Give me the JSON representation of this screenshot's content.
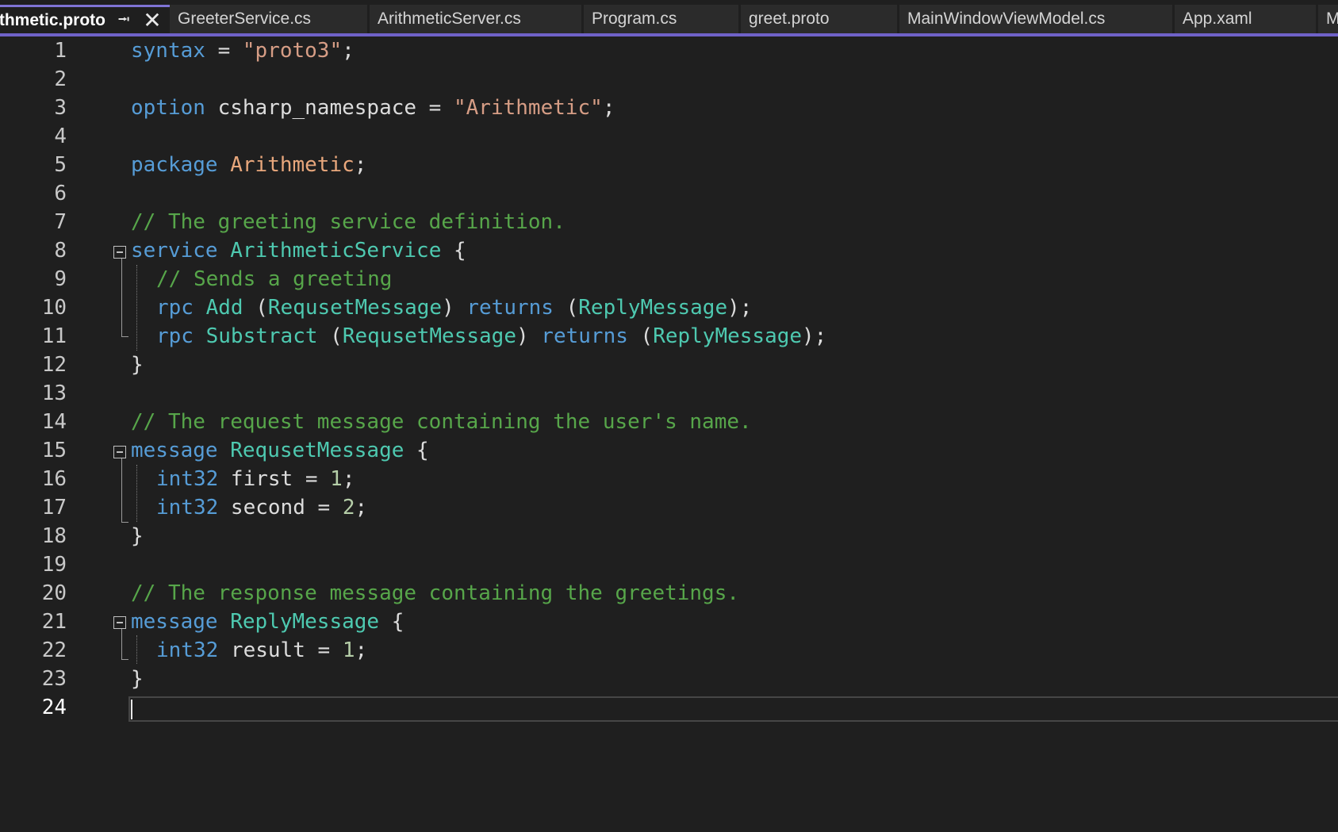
{
  "tabs": [
    {
      "label": "thmetic.proto",
      "active": true
    },
    {
      "label": "GreeterService.cs",
      "active": false
    },
    {
      "label": "ArithmeticServer.cs",
      "active": false
    },
    {
      "label": "Program.cs",
      "active": false
    },
    {
      "label": "greet.proto",
      "active": false
    },
    {
      "label": "MainWindowViewModel.cs",
      "active": false
    },
    {
      "label": "App.xaml",
      "active": false
    },
    {
      "label": "M",
      "active": false
    }
  ],
  "tab_icons": {
    "pin": "pin-icon",
    "close": "close-icon"
  },
  "current_line": 24,
  "colors": {
    "background": "#1f1f1f",
    "keyword": "#569cd6",
    "string": "#d69d85",
    "comment": "#57a64a",
    "type": "#4ec9b0",
    "number": "#b5cea8",
    "accent": "#7f73d4"
  },
  "lines": [
    {
      "n": "1",
      "indent": false,
      "tokens": [
        [
          "kw",
          "syntax"
        ],
        [
          "pl",
          " = "
        ],
        [
          "str",
          "\"proto3\""
        ],
        [
          "pl",
          ";"
        ]
      ]
    },
    {
      "n": "2",
      "indent": false,
      "tokens": []
    },
    {
      "n": "3",
      "indent": false,
      "tokens": [
        [
          "kw",
          "option"
        ],
        [
          "pl",
          " csharp_namespace = "
        ],
        [
          "str",
          "\"Arithmetic\""
        ],
        [
          "pl",
          ";"
        ]
      ]
    },
    {
      "n": "4",
      "indent": false,
      "tokens": []
    },
    {
      "n": "5",
      "indent": false,
      "tokens": [
        [
          "kw",
          "package"
        ],
        [
          "pl",
          " "
        ],
        [
          "ns",
          "Arithmetic"
        ],
        [
          "pl",
          ";"
        ]
      ]
    },
    {
      "n": "6",
      "indent": false,
      "tokens": []
    },
    {
      "n": "7",
      "indent": false,
      "tokens": [
        [
          "cmt",
          "// The greeting service definition."
        ]
      ]
    },
    {
      "n": "8",
      "indent": false,
      "fold": true,
      "tokens": [
        [
          "kw",
          "service"
        ],
        [
          "pl",
          " "
        ],
        [
          "typ",
          "ArithmeticService"
        ],
        [
          "pl",
          " {"
        ]
      ]
    },
    {
      "n": "9",
      "indent": true,
      "tokens": [
        [
          "cmt",
          "// Sends a greeting"
        ]
      ]
    },
    {
      "n": "10",
      "indent": true,
      "tokens": [
        [
          "kw",
          "rpc"
        ],
        [
          "pl",
          " "
        ],
        [
          "typ",
          "Add"
        ],
        [
          "pl",
          " ("
        ],
        [
          "typ",
          "RequsetMessage"
        ],
        [
          "pl",
          ") "
        ],
        [
          "kw",
          "returns"
        ],
        [
          "pl",
          " ("
        ],
        [
          "typ",
          "ReplyMessage"
        ],
        [
          "pl",
          ");"
        ]
      ]
    },
    {
      "n": "11",
      "indent": true,
      "tokens": [
        [
          "kw",
          "rpc"
        ],
        [
          "pl",
          " "
        ],
        [
          "typ",
          "Substract"
        ],
        [
          "pl",
          " ("
        ],
        [
          "typ",
          "RequsetMessage"
        ],
        [
          "pl",
          ") "
        ],
        [
          "kw",
          "returns"
        ],
        [
          "pl",
          " ("
        ],
        [
          "typ",
          "ReplyMessage"
        ],
        [
          "pl",
          ");"
        ]
      ]
    },
    {
      "n": "12",
      "indent": false,
      "tokens": [
        [
          "pl",
          "}"
        ]
      ]
    },
    {
      "n": "13",
      "indent": false,
      "tokens": []
    },
    {
      "n": "14",
      "indent": false,
      "tokens": [
        [
          "cmt",
          "// The request message containing the user's name."
        ]
      ]
    },
    {
      "n": "15",
      "indent": false,
      "fold": true,
      "tokens": [
        [
          "kw",
          "message"
        ],
        [
          "pl",
          " "
        ],
        [
          "typ",
          "RequsetMessage"
        ],
        [
          "pl",
          " {"
        ]
      ]
    },
    {
      "n": "16",
      "indent": true,
      "tokens": [
        [
          "kw",
          "int32"
        ],
        [
          "pl",
          " first = "
        ],
        [
          "num",
          "1"
        ],
        [
          "pl",
          ";"
        ]
      ]
    },
    {
      "n": "17",
      "indent": true,
      "tokens": [
        [
          "kw",
          "int32"
        ],
        [
          "pl",
          " second = "
        ],
        [
          "num",
          "2"
        ],
        [
          "pl",
          ";"
        ]
      ]
    },
    {
      "n": "18",
      "indent": false,
      "tokens": [
        [
          "pl",
          "}"
        ]
      ]
    },
    {
      "n": "19",
      "indent": false,
      "tokens": []
    },
    {
      "n": "20",
      "indent": false,
      "tokens": [
        [
          "cmt",
          "// The response message containing the greetings."
        ]
      ]
    },
    {
      "n": "21",
      "indent": false,
      "fold": true,
      "tokens": [
        [
          "kw",
          "message"
        ],
        [
          "pl",
          " "
        ],
        [
          "typ",
          "ReplyMessage"
        ],
        [
          "pl",
          " {"
        ]
      ]
    },
    {
      "n": "22",
      "indent": true,
      "tokens": [
        [
          "kw",
          "int32"
        ],
        [
          "pl",
          " result = "
        ],
        [
          "num",
          "1"
        ],
        [
          "pl",
          ";"
        ]
      ]
    },
    {
      "n": "23",
      "indent": false,
      "tokens": [
        [
          "pl",
          "}"
        ]
      ]
    },
    {
      "n": "24",
      "indent": false,
      "tokens": []
    }
  ]
}
